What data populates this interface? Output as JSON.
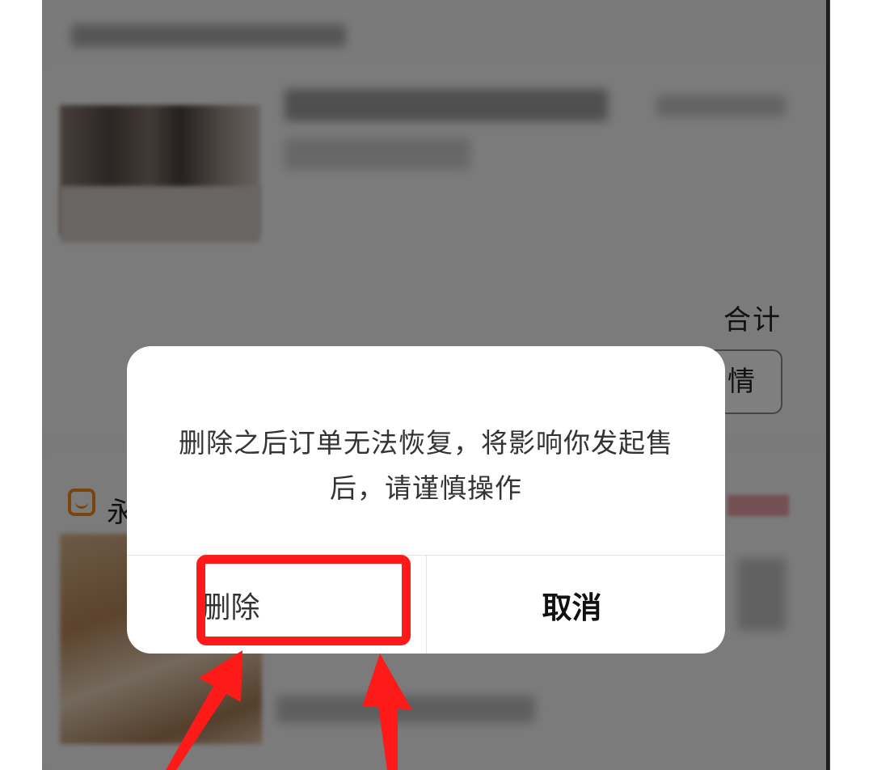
{
  "dialog": {
    "message": "删除之后订单无法恢复，将影响你发起售后，请谨慎操作",
    "delete_label": "删除",
    "cancel_label": "取消"
  },
  "background": {
    "partial_heading": "合计",
    "order_detail_partial": "情",
    "shop_name_partial": "永"
  },
  "colors": {
    "highlight": "#ff1a1a",
    "overlay": "rgba(0,0,0,0.5)",
    "shop_icon": "#f08a1c"
  },
  "icons": {
    "shop_icon": "shop-icon"
  }
}
